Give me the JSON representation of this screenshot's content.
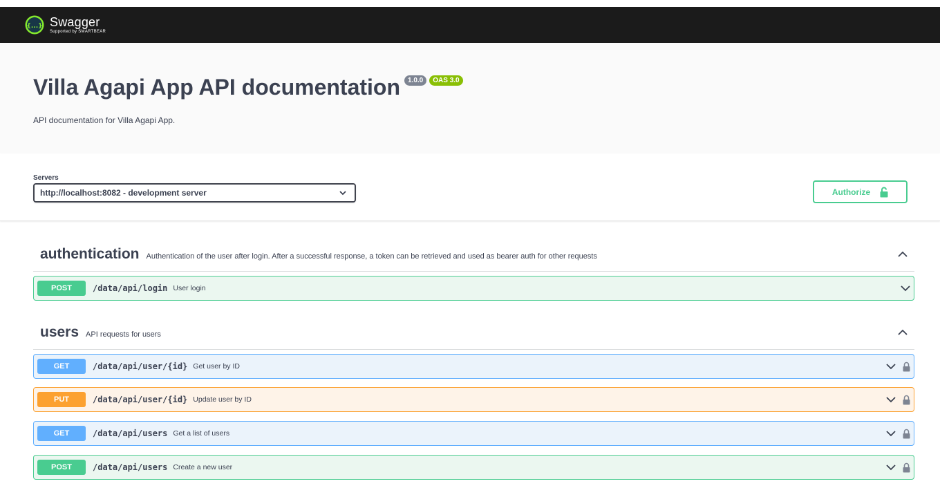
{
  "brand": {
    "name": "Swagger",
    "tagline": "Supported by SMARTBEAR",
    "logo_glyph": "{...}"
  },
  "info": {
    "title": "Villa Agapi App API documentation",
    "version_badge": "1.0.0",
    "oas_badge": "OAS 3.0",
    "description": "API documentation for Villa Agapi App."
  },
  "servers": {
    "label": "Servers",
    "selected": "http://localhost:8082 - development server"
  },
  "authorize": {
    "label": "Authorize"
  },
  "tags": [
    {
      "name": "authentication",
      "description": "Authentication of the user after login. After a successful response, a token can be retrieved and used as bearer auth for other requests",
      "operations": [
        {
          "method": "POST",
          "path": "/data/api/login",
          "summary": "User login"
        }
      ]
    },
    {
      "name": "users",
      "description": "API requests for users",
      "operations": [
        {
          "method": "GET",
          "path": "/data/api/user/{id}",
          "summary": "Get user by ID"
        },
        {
          "method": "PUT",
          "path": "/data/api/user/{id}",
          "summary": "Update user by ID"
        },
        {
          "method": "GET",
          "path": "/data/api/users",
          "summary": "Get a list of users"
        },
        {
          "method": "POST",
          "path": "/data/api/users",
          "summary": "Create a new user"
        }
      ]
    }
  ],
  "colors": {
    "post": "#49cc90",
    "get": "#61affe",
    "put": "#fca130",
    "oas_badge": "#89bf04",
    "version_badge": "#7d8492",
    "topbar": "#1b1b1b"
  }
}
